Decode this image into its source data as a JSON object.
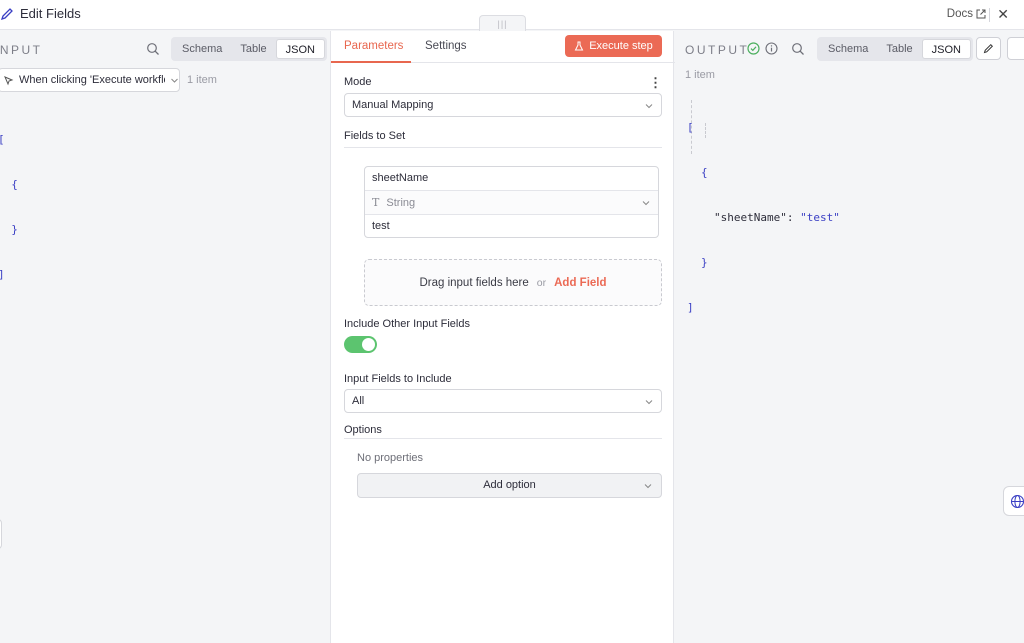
{
  "header": {
    "title": "Edit Fields",
    "docs_label": "Docs",
    "close_glyph": "✕"
  },
  "input": {
    "label": "INPUT",
    "views": [
      "Schema",
      "Table",
      "JSON"
    ],
    "active_view": "JSON",
    "node_select": "When clicking 'Execute workflow'",
    "items_count": "1 item",
    "json_lines": [
      "[",
      "  {",
      "  }",
      "]"
    ]
  },
  "params": {
    "tabs": [
      "Parameters",
      "Settings"
    ],
    "execute_label": "Execute step",
    "mode_label": "Mode",
    "mode_value": "Manual Mapping",
    "fields_to_set_label": "Fields to Set",
    "field": {
      "name": "sheetName",
      "type": "String",
      "value": "test"
    },
    "drop_text": "Drag input fields here",
    "drop_or": "or",
    "add_field_label": "Add Field",
    "include_other_label": "Include Other Input Fields",
    "include_other_on": true,
    "input_fields_label": "Input Fields to Include",
    "input_fields_value": "All",
    "options_label": "Options",
    "no_properties": "No properties",
    "add_option_label": "Add option"
  },
  "output": {
    "label": "OUTPUT",
    "views": [
      "Schema",
      "Table",
      "JSON"
    ],
    "active_view": "JSON",
    "items_count": "1 item",
    "json_open": "[",
    "json_obj_open": "{",
    "json_key": "\"sheetName\"",
    "json_colon": ": ",
    "json_value": "\"test\"",
    "json_obj_close": "}",
    "json_close": "]"
  },
  "colors": {
    "accent": "#eb6a55",
    "success": "#5cc46f",
    "json": "#3a3fc4"
  }
}
